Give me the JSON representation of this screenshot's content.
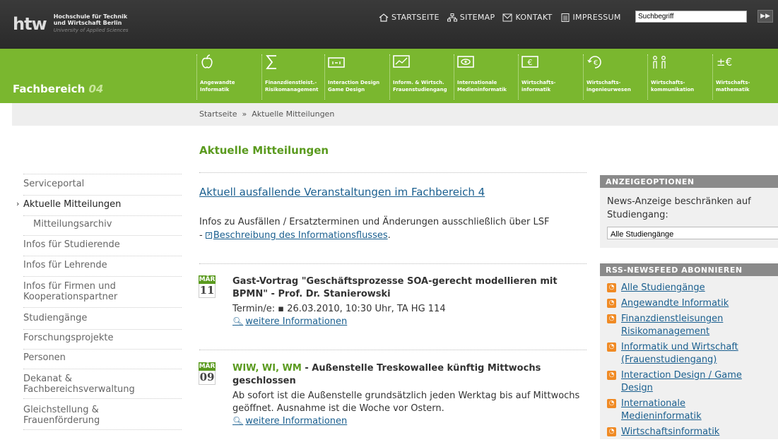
{
  "header": {
    "logo_mark": "htw",
    "logo_line1": "Hochschule für Technik",
    "logo_line2": "und Wirtschaft Berlin",
    "logo_line3": "University of Applied Sciences",
    "nav": [
      {
        "label": "STARTSEITE",
        "icon": "home-icon"
      },
      {
        "label": "SITEMAP",
        "icon": "sitemap-icon"
      },
      {
        "label": "KONTAKT",
        "icon": "contact-icon"
      },
      {
        "label": "IMPRESSUM",
        "icon": "document-icon"
      }
    ],
    "search_value": "Suchbegriff",
    "search_button": "▶▶"
  },
  "department": {
    "title": "Fachbereich",
    "number": "04",
    "programs": [
      {
        "line1": "Angewandte",
        "line2": "Informatik",
        "icon": "apple-icon"
      },
      {
        "line1": "Finanzdienstleist.-",
        "line2": "Risikomanagement",
        "icon": "sigma-icon"
      },
      {
        "line1": "Interaction Design",
        "line2": "Game Design",
        "icon": "screen-icon"
      },
      {
        "line1": "Inform. & Wirtsch.",
        "line2": "Frauenstudiengang",
        "icon": "chart-icon"
      },
      {
        "line1": "Internationale",
        "line2": "Medieninformatik",
        "icon": "eye-icon"
      },
      {
        "line1": "Wirtschafts-",
        "line2": "informatik",
        "icon": "euro-screen-icon"
      },
      {
        "line1": "Wirtschafts-",
        "line2": "ingenieurwesen",
        "icon": "euro-cycle-icon"
      },
      {
        "line1": "Wirtschafts-",
        "line2": "kommunikation",
        "icon": "people-icon"
      },
      {
        "line1": "Wirtschafts-",
        "line2": "mathematik",
        "icon": "plusminus-euro-icon"
      }
    ]
  },
  "breadcrumb": {
    "home": "Startseite",
    "separator": "»",
    "current": "Aktuelle Mitteilungen"
  },
  "page_title": "Aktuelle Mitteilungen",
  "sidebar": {
    "items": [
      {
        "label": "Serviceportal"
      },
      {
        "label": "Aktuelle Mitteilungen"
      },
      {
        "label": "Mitteilungsarchiv"
      },
      {
        "label": "Infos für Studierende"
      },
      {
        "label": "Infos für Lehrende"
      },
      {
        "label": "Infos für Firmen und Kooperationspartner"
      },
      {
        "label": "Studiengänge"
      },
      {
        "label": "Forschungsprojekte"
      },
      {
        "label": "Personen"
      },
      {
        "label": "Dekanat & Fachbereichsverwaltung"
      },
      {
        "label": "Gleichstellung & Frauenförderung"
      }
    ]
  },
  "announcement": {
    "link": "Aktuell ausfallende Veranstaltungen im Fachbereich 4",
    "text": "Infos zu Ausfällen / Ersatzterminen und Änderungen ausschließlich über LSF",
    "dash": "-",
    "info_link": "Beschreibung des Informationsflusses",
    "info_suffix": "."
  },
  "news": [
    {
      "month": "MÄR",
      "day": "11",
      "tag": "",
      "headline": "Gast-Vortrag \"Geschäftsprozesse SOA-gerecht modellieren mit BPMN\" - Prof. Dr. Stanierowski",
      "body": "Termin/e:  ▪ 26.03.2010, 10:30 Uhr, TA HG 114",
      "more": "weitere Informationen"
    },
    {
      "month": "MÄR",
      "day": "09",
      "tag": "WIW, WI, WM",
      "headline": " - Außenstelle Treskowallee künftig Mittwochs geschlossen",
      "body": "Ab sofort ist die Außenstelle grundsätzlich jeden Werktag bis auf Mittwochs geöffnet. Ausnahme ist die Woche vor Ostern.",
      "more": "weitere Informationen"
    }
  ],
  "options_box": {
    "heading": "ANZEIGEOPTIONEN",
    "text": "News-Anzeige beschränken auf Studiengang:",
    "select_value": "Alle Studiengänge"
  },
  "rss_box": {
    "heading": "RSS-NEWSFEED ABONNIEREN",
    "items": [
      {
        "label": "Alle Studiengänge"
      },
      {
        "label": "Angewandte Informatik"
      },
      {
        "label": "Finanzdienstleisungen Risikomanagement"
      },
      {
        "label": "Informatik und Wirtschaft (Frauenstudiengang)"
      },
      {
        "label": "Interaction Design / Game Design"
      },
      {
        "label": "Internationale Medieninformatik"
      },
      {
        "label": "Wirtschaftsinformatik"
      }
    ]
  },
  "colors": {
    "green": "#7ab72f",
    "dark_green": "#5a9a1e",
    "link": "#1a5f8f",
    "header": "#333333",
    "rss": "#f08a24"
  }
}
